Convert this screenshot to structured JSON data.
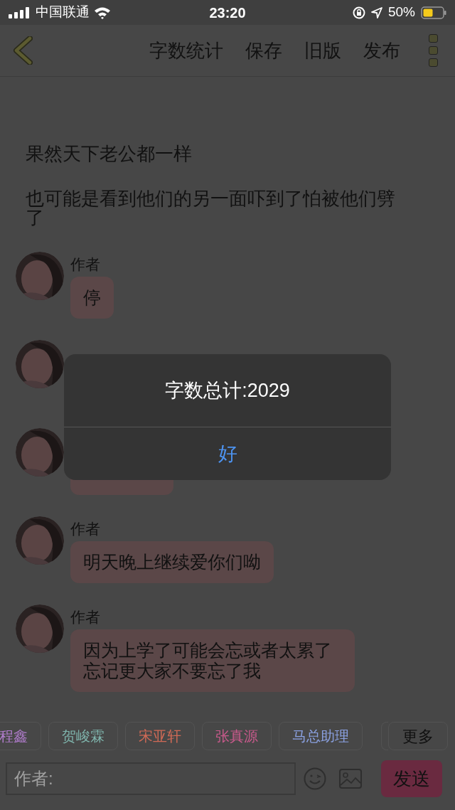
{
  "status_bar": {
    "carrier": "中国联通",
    "time": "23:20",
    "battery": "50%"
  },
  "nav": {
    "actions": [
      "字数统计",
      "保存",
      "旧版",
      "发布"
    ]
  },
  "paragraphs": [
    "果然天下老公都一样",
    "也可能是看到他们的另一面吓到了怕被他们劈了"
  ],
  "messages": [
    {
      "author": "作者",
      "text": "停"
    },
    {
      "kind": "covered"
    },
    {
      "kind": "covered-bubble"
    },
    {
      "author": "作者",
      "text": "明天晚上继续爱你们呦"
    },
    {
      "author": "作者",
      "text": "因为上学了可能会忘或者太累了忘记更大家不要忘了我"
    }
  ],
  "tags": [
    {
      "label": "程鑫",
      "color": "#b07ccc"
    },
    {
      "label": "贺峻霖",
      "color": "#7fb5ad"
    },
    {
      "label": "宋亚轩",
      "color": "#d06a56"
    },
    {
      "label": "张真源",
      "color": "#c95a8c"
    },
    {
      "label": "马总助理",
      "color": "#8aa0e0"
    }
  ],
  "more_button": "更多",
  "composer": {
    "placeholder": "作者:",
    "send": "发送"
  },
  "dialog": {
    "message": "字数总计:2029",
    "button": "好"
  }
}
